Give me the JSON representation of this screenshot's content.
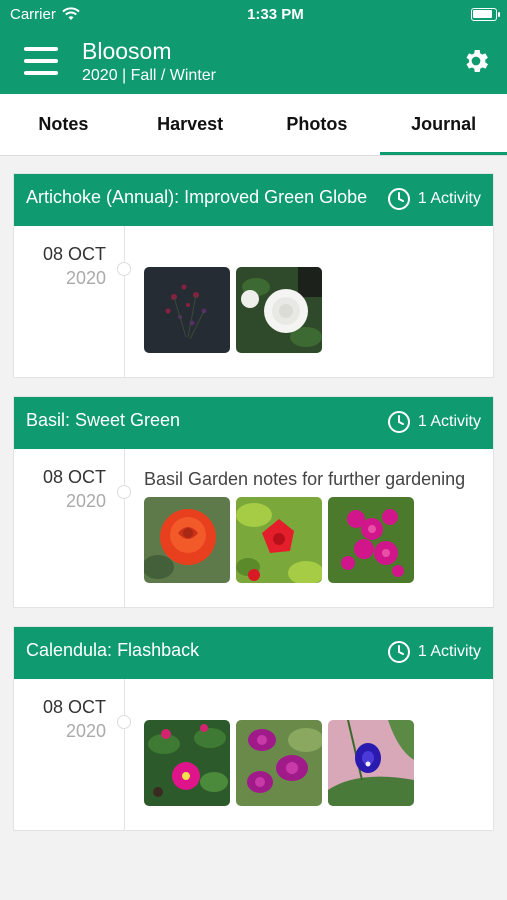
{
  "status": {
    "carrier": "Carrier",
    "time": "1:33 PM"
  },
  "appbar": {
    "title": "Bloosom",
    "subtitle": "2020 | Fall / Winter"
  },
  "tabs": [
    {
      "label": "Notes",
      "active": false
    },
    {
      "label": "Harvest",
      "active": false
    },
    {
      "label": "Photos",
      "active": false
    },
    {
      "label": "Journal",
      "active": true
    }
  ],
  "colors": {
    "accent": "#0f9a6f"
  },
  "cards": [
    {
      "name": "Artichoke (Annual): Improved Green Globe",
      "activity": "1 Activity",
      "date": "08 OCT",
      "year": "2020",
      "note": "",
      "photos": [
        "dark-flower-photo",
        "white-gardenia-photo"
      ]
    },
    {
      "name": "Basil: Sweet Green",
      "activity": "1 Activity",
      "date": "08 OCT",
      "year": "2020",
      "note": "Basil Garden notes for further gardening",
      "photos": [
        "red-rose-photo",
        "red-hibiscus-photo",
        "pink-bougainvillea-photo"
      ]
    },
    {
      "name": "Calendula: Flashback",
      "activity": "1 Activity",
      "date": "08 OCT",
      "year": "2020",
      "note": "",
      "photos": [
        "pink-flower-bush-photo",
        "purple-orchid-photo",
        "blue-pea-flower-photo"
      ]
    }
  ]
}
